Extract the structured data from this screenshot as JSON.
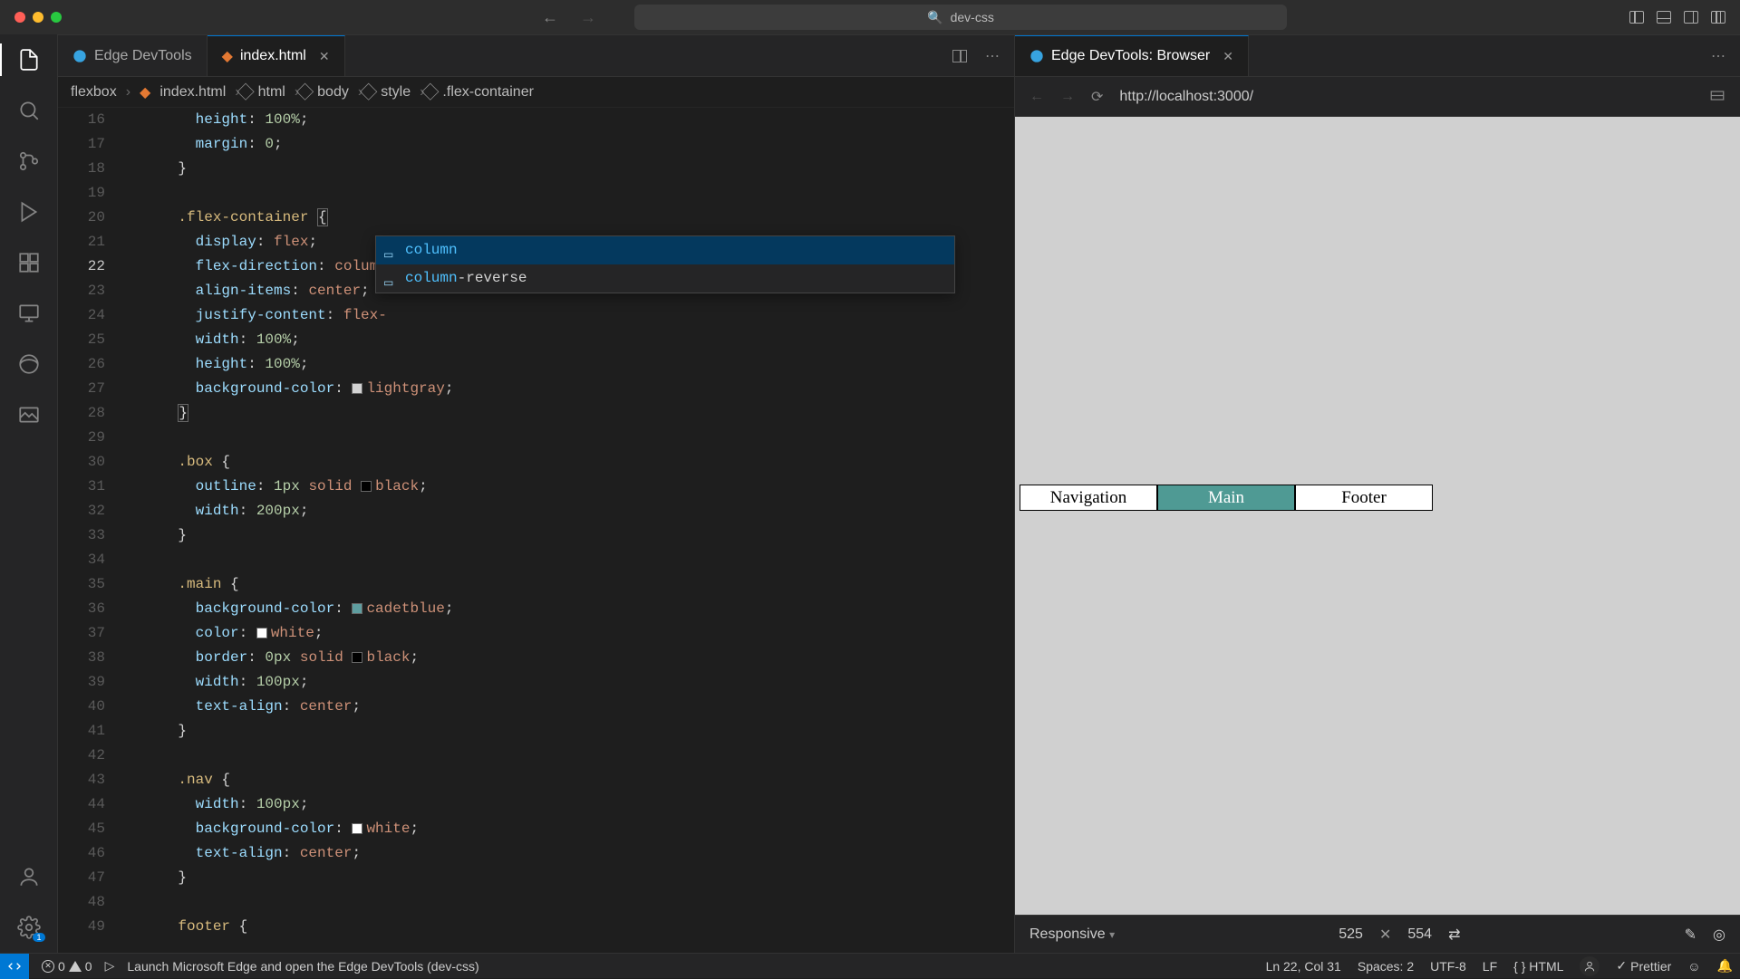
{
  "titlebar": {
    "search_placeholder": "dev-css"
  },
  "tabs": {
    "left": [
      {
        "label": "Edge DevTools",
        "active": false,
        "closable": false
      },
      {
        "label": "index.html",
        "active": true,
        "closable": true
      }
    ],
    "right": [
      {
        "label": "Edge DevTools: Browser",
        "active": true,
        "closable": true
      }
    ]
  },
  "breadcrumb": {
    "items": [
      "flexbox",
      "index.html",
      "html",
      "body",
      "style",
      ".flex-container"
    ]
  },
  "code": {
    "first_line_no": 16,
    "active_line_no": 22,
    "lines": [
      {
        "n": 16,
        "html": "      <span class='tok-prop'>height</span><span class='tok-default'>: </span><span class='tok-num'>100%</span><span class='tok-default'>;</span>"
      },
      {
        "n": 17,
        "html": "      <span class='tok-prop'>margin</span><span class='tok-default'>: </span><span class='tok-num'>0</span><span class='tok-default'>;</span>"
      },
      {
        "n": 18,
        "html": "    <span class='tok-default'>}</span>"
      },
      {
        "n": 19,
        "html": ""
      },
      {
        "n": 20,
        "html": "    <span class='tok-sel'>.flex-container</span> <span class='tok-default match-brace'>{</span>"
      },
      {
        "n": 21,
        "html": "      <span class='tok-prop'>display</span><span class='tok-default'>: </span><span class='tok-val'>flex</span><span class='tok-default'>;</span>"
      },
      {
        "n": 22,
        "html": "      <span class='tok-prop'>flex-direction</span><span class='tok-default'>: </span><span class='tok-val'>column</span><span class='cursor'></span><span class='tok-default'>;</span>"
      },
      {
        "n": 23,
        "html": "      <span class='tok-prop'>align-items</span><span class='tok-default'>: </span><span class='tok-val'>center</span><span class='tok-default'>;</span>"
      },
      {
        "n": 24,
        "html": "      <span class='tok-prop'>justify-content</span><span class='tok-default'>: </span><span class='tok-val'>flex-</span>"
      },
      {
        "n": 25,
        "html": "      <span class='tok-prop'>width</span><span class='tok-default'>: </span><span class='tok-num'>100%</span><span class='tok-default'>;</span>"
      },
      {
        "n": 26,
        "html": "      <span class='tok-prop'>height</span><span class='tok-default'>: </span><span class='tok-num'>100%</span><span class='tok-default'>;</span>"
      },
      {
        "n": 27,
        "html": "      <span class='tok-prop'>background-color</span><span class='tok-default'>: </span><span class='tok-colorbox' style='background:#d3d3d3'></span><span class='tok-val'>lightgray</span><span class='tok-default'>;</span>"
      },
      {
        "n": 28,
        "html": "    <span class='tok-default match-brace'>}</span>"
      },
      {
        "n": 29,
        "html": ""
      },
      {
        "n": 30,
        "html": "    <span class='tok-sel'>.box</span> <span class='tok-default'>{</span>"
      },
      {
        "n": 31,
        "html": "      <span class='tok-prop'>outline</span><span class='tok-default'>: </span><span class='tok-num'>1px</span> <span class='tok-val'>solid</span> <span class='tok-colorbox' style='background:#000'></span><span class='tok-val'>black</span><span class='tok-default'>;</span>"
      },
      {
        "n": 32,
        "html": "      <span class='tok-prop'>width</span><span class='tok-default'>: </span><span class='tok-num'>200px</span><span class='tok-default'>;</span>"
      },
      {
        "n": 33,
        "html": "    <span class='tok-default'>}</span>"
      },
      {
        "n": 34,
        "html": ""
      },
      {
        "n": 35,
        "html": "    <span class='tok-sel'>.main</span> <span class='tok-default'>{</span>"
      },
      {
        "n": 36,
        "html": "      <span class='tok-prop'>background-color</span><span class='tok-default'>: </span><span class='tok-colorbox' style='background:#5f9ea0'></span><span class='tok-val'>cadetblue</span><span class='tok-default'>;</span>"
      },
      {
        "n": 37,
        "html": "      <span class='tok-prop'>color</span><span class='tok-default'>: </span><span class='tok-colorbox' style='background:#fff'></span><span class='tok-val'>white</span><span class='tok-default'>;</span>"
      },
      {
        "n": 38,
        "html": "      <span class='tok-prop'>border</span><span class='tok-default'>: </span><span class='tok-num'>0px</span> <span class='tok-val'>solid</span> <span class='tok-colorbox' style='background:#000'></span><span class='tok-val'>black</span><span class='tok-default'>;</span>"
      },
      {
        "n": 39,
        "html": "      <span class='tok-prop'>width</span><span class='tok-default'>: </span><span class='tok-num'>100px</span><span class='tok-default'>;</span>"
      },
      {
        "n": 40,
        "html": "      <span class='tok-prop'>text-align</span><span class='tok-default'>: </span><span class='tok-val'>center</span><span class='tok-default'>;</span>"
      },
      {
        "n": 41,
        "html": "    <span class='tok-default'>}</span>"
      },
      {
        "n": 42,
        "html": ""
      },
      {
        "n": 43,
        "html": "    <span class='tok-sel'>.nav</span> <span class='tok-default'>{</span>"
      },
      {
        "n": 44,
        "html": "      <span class='tok-prop'>width</span><span class='tok-default'>: </span><span class='tok-num'>100px</span><span class='tok-default'>;</span>"
      },
      {
        "n": 45,
        "html": "      <span class='tok-prop'>background-color</span><span class='tok-default'>: </span><span class='tok-colorbox' style='background:#fff'></span><span class='tok-val'>white</span><span class='tok-default'>;</span>"
      },
      {
        "n": 46,
        "html": "      <span class='tok-prop'>text-align</span><span class='tok-default'>: </span><span class='tok-val'>center</span><span class='tok-default'>;</span>"
      },
      {
        "n": 47,
        "html": "    <span class='tok-default'>}</span>"
      },
      {
        "n": 48,
        "html": ""
      },
      {
        "n": 49,
        "html": "    <span class='tok-sel'>footer</span> <span class='tok-default'>{</span>"
      }
    ]
  },
  "suggest": {
    "items": [
      {
        "match": "column",
        "rest": "",
        "selected": true
      },
      {
        "match": "column",
        "rest": "-reverse",
        "selected": false
      }
    ]
  },
  "browser": {
    "url": "http://localhost:3000/",
    "boxes": {
      "nav": "Navigation",
      "main": "Main",
      "footer": "Footer"
    },
    "status": {
      "mode": "Responsive",
      "w": "525",
      "h": "554"
    }
  },
  "statusbar": {
    "errors": "0",
    "warnings": "0",
    "launch_msg": "Launch Microsoft Edge and open the Edge DevTools (dev-css)",
    "cursor": "Ln 22, Col 31",
    "spaces": "Spaces: 2",
    "encoding": "UTF-8",
    "eol": "LF",
    "lang": "HTML",
    "prettier": "Prettier"
  },
  "activity_badge": "1"
}
